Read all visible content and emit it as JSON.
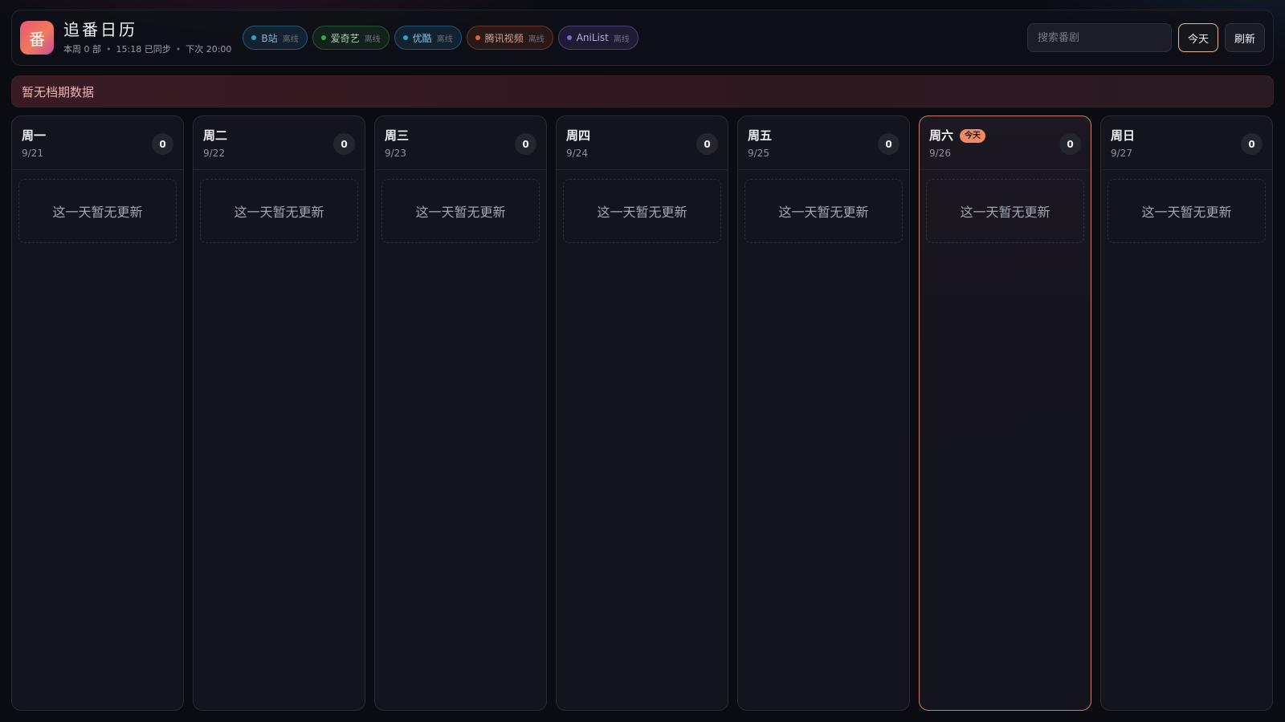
{
  "header": {
    "logo_char": "番",
    "title": "追番日历",
    "meta": {
      "week_count": "本周 0 部",
      "synced": "15:18 已同步",
      "next": "下次 20:00"
    },
    "sources": [
      {
        "name": "B站",
        "status": "离线"
      },
      {
        "name": "爱奇艺",
        "status": "离线"
      },
      {
        "name": "优酷",
        "status": "离线"
      },
      {
        "name": "腾讯视频",
        "status": "离线"
      },
      {
        "name": "AniList",
        "status": "离线"
      }
    ],
    "search": {
      "placeholder": "搜索番剧",
      "value": ""
    },
    "today_label": "今天",
    "refresh_label": "刷新"
  },
  "notice": "暂无档期数据",
  "today_badge": "今天",
  "days": [
    {
      "name": "周一",
      "date": "9/21",
      "count": "0",
      "empty": "这一天暂无更新"
    },
    {
      "name": "周二",
      "date": "9/22",
      "count": "0",
      "empty": "这一天暂无更新"
    },
    {
      "name": "周三",
      "date": "9/23",
      "count": "0",
      "empty": "这一天暂无更新"
    },
    {
      "name": "周四",
      "date": "9/24",
      "count": "0",
      "empty": "这一天暂无更新"
    },
    {
      "name": "周五",
      "date": "9/25",
      "count": "0",
      "empty": "这一天暂无更新"
    },
    {
      "name": "周六",
      "date": "9/26",
      "count": "0",
      "empty": "这一天暂无更新"
    },
    {
      "name": "周日",
      "date": "9/27",
      "count": "0",
      "empty": "这一天暂无更新"
    }
  ],
  "colors": {
    "accent": "#f08a63",
    "today_border": "#c87e6a",
    "notice_text": "#eab5b5",
    "bilibili": "#2aa4d0",
    "iqiyi": "#29b24a",
    "youku": "#23a6dc",
    "tencent": "#e4633c",
    "anilist": "#7b68d4"
  }
}
